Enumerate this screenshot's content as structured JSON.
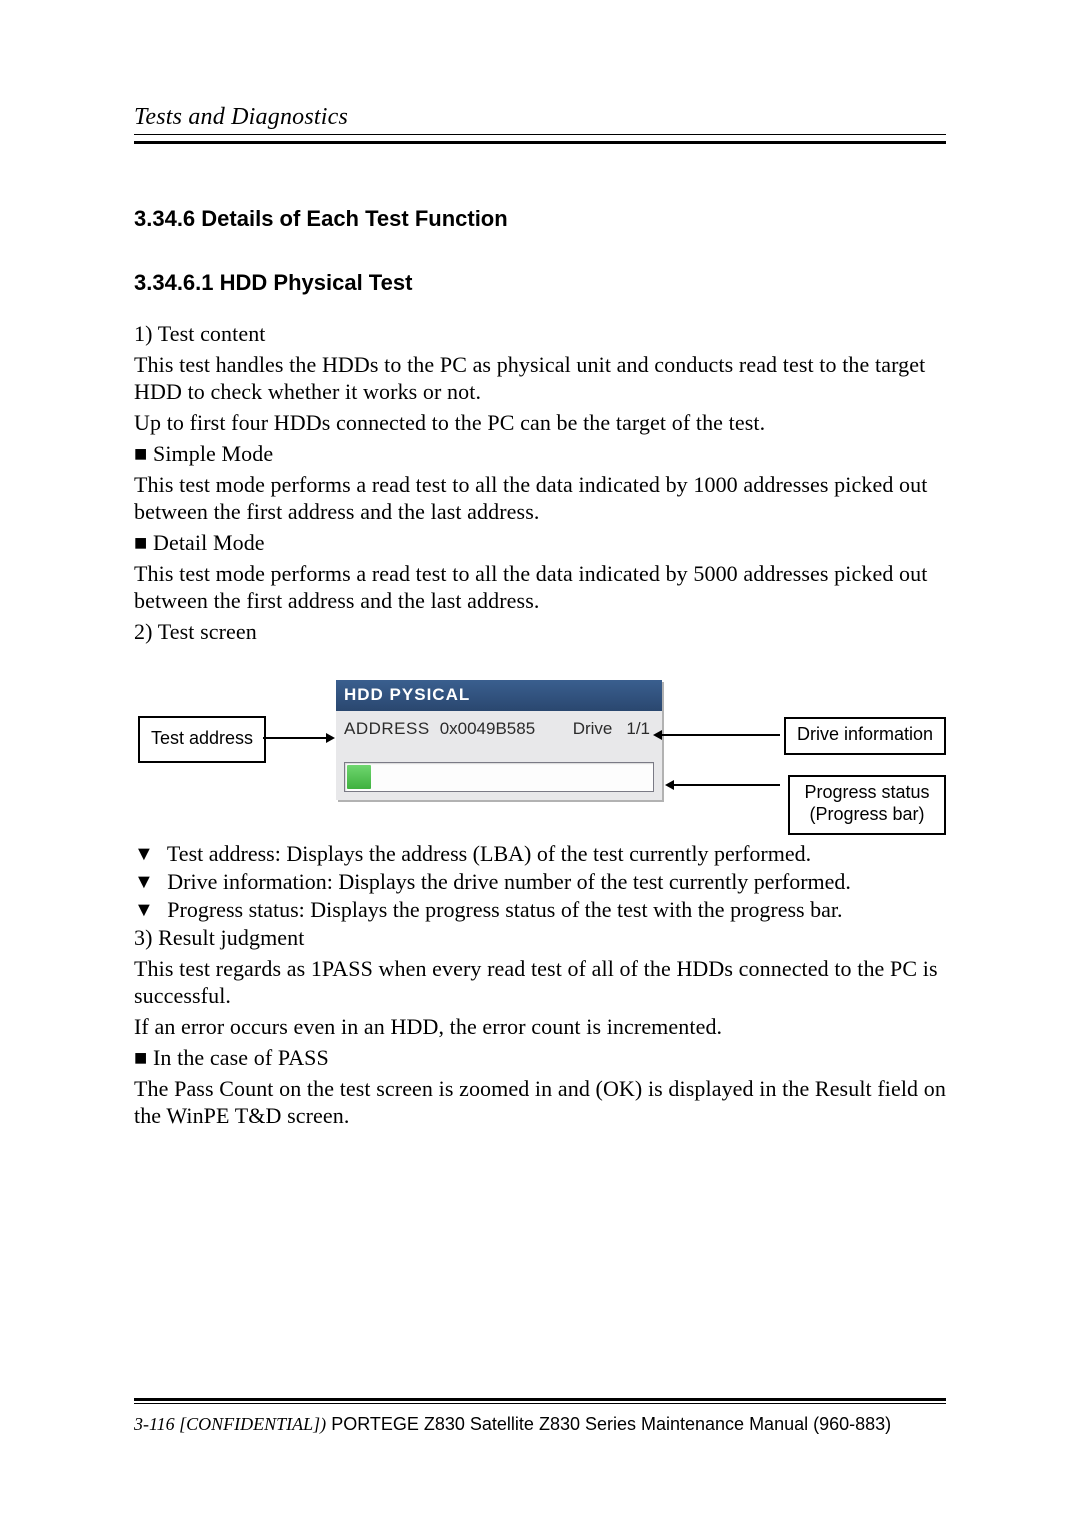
{
  "header": {
    "running": "Tests and Diagnostics"
  },
  "headings": {
    "h1": "3.34.6  Details of Each Test Function",
    "h2": "3.34.6.1  HDD Physical Test"
  },
  "para": {
    "p1": "1) Test content",
    "p2": "This test handles the HDDs to the PC as physical unit and conducts read test to the target HDD to check whether it works or not.",
    "p3": "Up to first four HDDs connected to the PC can be the target of the test.",
    "simple_head": "■ Simple Mode",
    "simple_body": "This test mode performs a read test to all the data indicated by 1000 addresses picked out between the first address and the last address.",
    "detail_head": "■ Detail Mode",
    "detail_body": "This test mode performs a read test to all the data indicated by 5000 addresses picked out between the first address and the last address.",
    "p_screen": "2) Test screen",
    "b1": " Test address: Displays the address (LBA) of the test currently performed.",
    "b2": " Drive information: Displays the drive number of the test currently performed.",
    "b3": " Progress status: Displays the progress status of the test with the progress bar.",
    "p_result_head": "3) Result judgment",
    "p_result_1": "This test regards as 1PASS when every read test of all of the HDDs connected to the PC is successful.",
    "p_result_2": "If an error occurs even in an HDD, the error count is incremented.",
    "pass_head": "■ In the case of PASS",
    "pass_body": "The Pass Count on the test screen is zoomed in and (OK) is displayed in the Result field on the WinPE T&D screen."
  },
  "diagram": {
    "callout_left": "Test address",
    "callout_right": "Drive information",
    "callout_right2_l1": "Progress status",
    "callout_right2_l2": "(Progress bar)",
    "panel_title": "HDD PYSICAL",
    "addr_label": "ADDRESS",
    "addr_value": "0x0049B585",
    "drive_label": "Drive",
    "drive_value": "1/1"
  },
  "footer": {
    "left_it": "3-116 [CONFIDENTIAL])",
    "right": " PORTEGE Z830 Satellite Z830 Series Maintenance Manual (960-883)"
  }
}
